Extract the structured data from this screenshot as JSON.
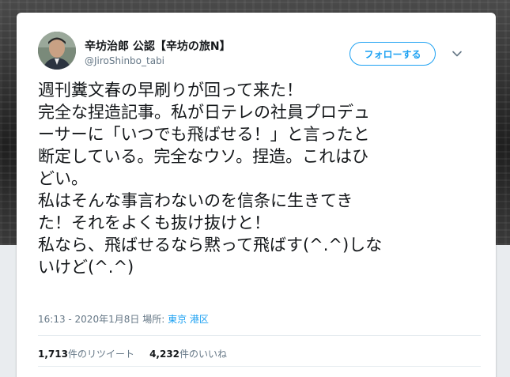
{
  "author": {
    "display_name": "辛坊治郎 公認【辛坊の旅N】",
    "handle": "@JiroShinbo_tabi"
  },
  "follow_button_label": "フォローする",
  "tweet_lines": [
    "週刊糞文春の早刷りが回って来た！",
    "完全な捏造記事。私が日テレの社員プロデュ",
    "ーサーに「いつでも飛ばせる！」と言ったと",
    "断定している。完全なウソ。捏造。これはひ",
    "どい。",
    "私はそんな事言わないのを信条に生きてき",
    "た！それをよくも抜け抜けと！",
    "私なら、飛ばせるなら黙って飛ばす(^.^)しな",
    "いけど(^.^)"
  ],
  "meta": {
    "timestamp": "16:13 - 2020年1月8日",
    "location_label": "場所:",
    "location": "東京 港区"
  },
  "stats": {
    "retweets_count": "1,713",
    "retweets_label": "件のリツイート",
    "likes_count": "4,232",
    "likes_label": "件のいいね"
  },
  "colors": {
    "accent": "#1da1f2",
    "text": "#14171a",
    "muted": "#657786"
  },
  "icons": {
    "caret": "chevron-down-icon"
  }
}
